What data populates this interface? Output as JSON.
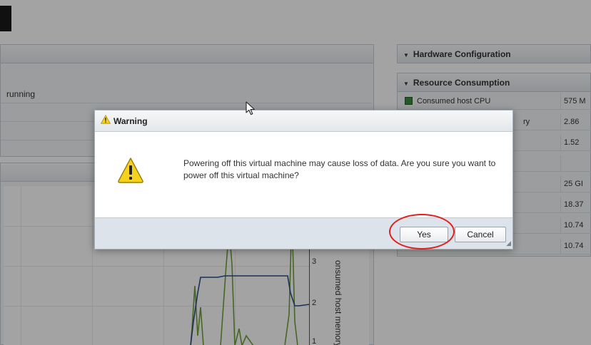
{
  "left_panel": {
    "status_text": "running"
  },
  "chart": {
    "y_ticks": [
      "3",
      "2",
      "1"
    ],
    "axis_label": "onsumed host memory"
  },
  "hardware_panel": {
    "title": "Hardware Configuration"
  },
  "resource_panel": {
    "title": "Resource Consumption",
    "rows": [
      {
        "label": "Consumed host CPU",
        "value": "575 M"
      },
      {
        "label": "ry",
        "value": "2.86"
      },
      {
        "label": "",
        "value": "1.52"
      },
      {
        "label": "",
        "value": ""
      },
      {
        "label": "",
        "value": "25 GI"
      },
      {
        "label": "",
        "value": "18.37"
      },
      {
        "label": "",
        "value": "10.74"
      },
      {
        "label": "",
        "value": "10.74"
      }
    ]
  },
  "dialog": {
    "title": "Warning",
    "message": "Powering off this virtual machine may cause loss of data. Are you sure you want to power off this virtual machine?",
    "yes_label": "Yes",
    "cancel_label": "Cancel"
  },
  "colors": {
    "warning_yellow": "#f7d21c",
    "highlight_ring": "#e02020",
    "series_green": "#6f9e3a",
    "series_blue": "#2b4f8a"
  },
  "icons": [
    "warning-icon",
    "cpu-icon",
    "collapse-caret-icon",
    "mouse-cursor-icon",
    "resize-grip-icon"
  ]
}
